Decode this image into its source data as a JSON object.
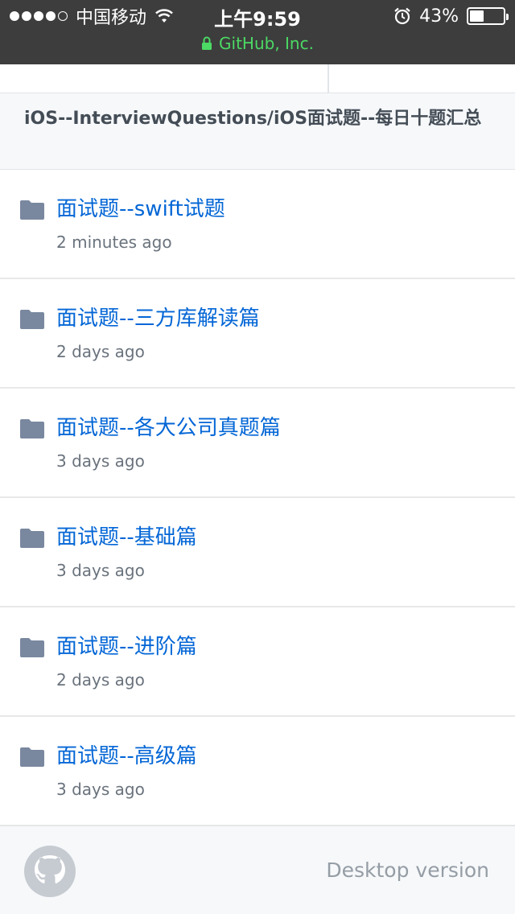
{
  "status_bar": {
    "carrier": "中国移动",
    "time": "上午9:59",
    "battery_percent_label": "43%",
    "battery_level": 0.43,
    "url_label": "GitHub, Inc.",
    "signal_icon": "signal-dots-icon",
    "wifi_icon": "wifi-icon",
    "alarm_icon": "alarm-clock-icon",
    "lock_icon": "lock-icon"
  },
  "breadcrumb": {
    "path": "iOS--InterviewQuestions/iOS面试题--每日十题汇总"
  },
  "entries": [
    {
      "name": "面试题--swift试题",
      "age": "2 minutes ago",
      "icon": "folder-icon"
    },
    {
      "name": "面试题--三方库解读篇",
      "age": "2 days ago",
      "icon": "folder-icon"
    },
    {
      "name": "面试题--各大公司真题篇",
      "age": "3 days ago",
      "icon": "folder-icon"
    },
    {
      "name": "面试题--基础篇",
      "age": "3 days ago",
      "icon": "folder-icon"
    },
    {
      "name": "面试题--进阶篇",
      "age": "2 days ago",
      "icon": "folder-icon"
    },
    {
      "name": "面试题--高级篇",
      "age": "3 days ago",
      "icon": "folder-icon"
    }
  ],
  "footer": {
    "desktop_label": "Desktop version",
    "logo_icon": "github-octocat-icon"
  },
  "colors": {
    "status_bar_bg": "#3d3d3d",
    "link_blue": "#0366d6",
    "muted_text": "#6a737d",
    "folder_icon": "#79889f",
    "secure_green": "#4cd964"
  }
}
